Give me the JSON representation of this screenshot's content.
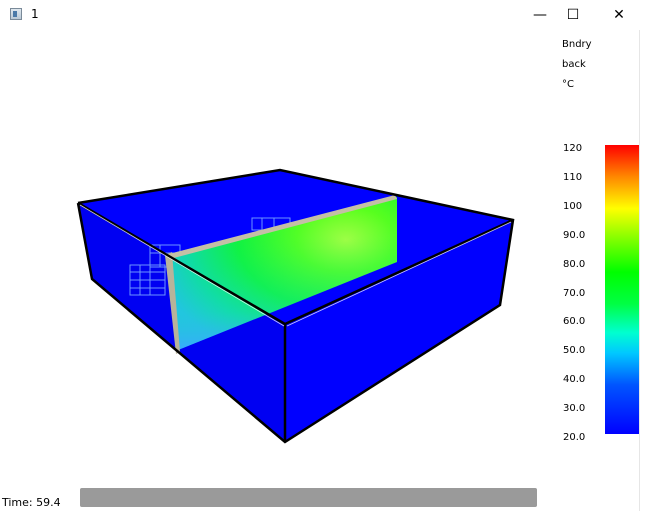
{
  "window": {
    "title": "1"
  },
  "controls": {
    "minimize": "—",
    "maximize": "☐",
    "close": "✕"
  },
  "view": {
    "boundary_label": "Bndry",
    "side_label": "back",
    "unit_label": "°C"
  },
  "legend": {
    "ticks": [
      "120",
      "110",
      "100",
      "90.0",
      "80.0",
      "70.0",
      "60.0",
      "50.0",
      "40.0",
      "30.0",
      "20.0"
    ],
    "min": 20,
    "max": 120
  },
  "status": {
    "time": "Time: 59.4",
    "progress": 1.0
  },
  "colors": {
    "domain_blue": "#0000ff",
    "wall_gray": "#b8b39a"
  }
}
